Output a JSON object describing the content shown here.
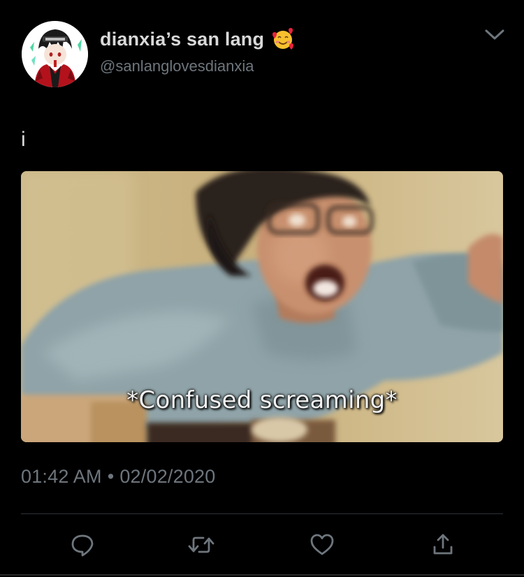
{
  "tweet": {
    "display_name": "dianxia’s san lang",
    "emoji": "smiling-face-with-hearts",
    "handle": "@sanlanglovesdianxia",
    "text": "i",
    "media": {
      "caption": "*Confused screaming*"
    },
    "time": "01:42 AM",
    "separator": "•",
    "date": "02/02/2020"
  },
  "actions": {
    "reply_icon": "reply-icon",
    "retweet_icon": "retweet-icon",
    "like_icon": "heart-icon",
    "share_icon": "share-icon"
  },
  "colors": {
    "background": "#000000",
    "primary_text": "#d9d9d9",
    "secondary_text": "#6e767d",
    "divider": "#2f3336"
  }
}
